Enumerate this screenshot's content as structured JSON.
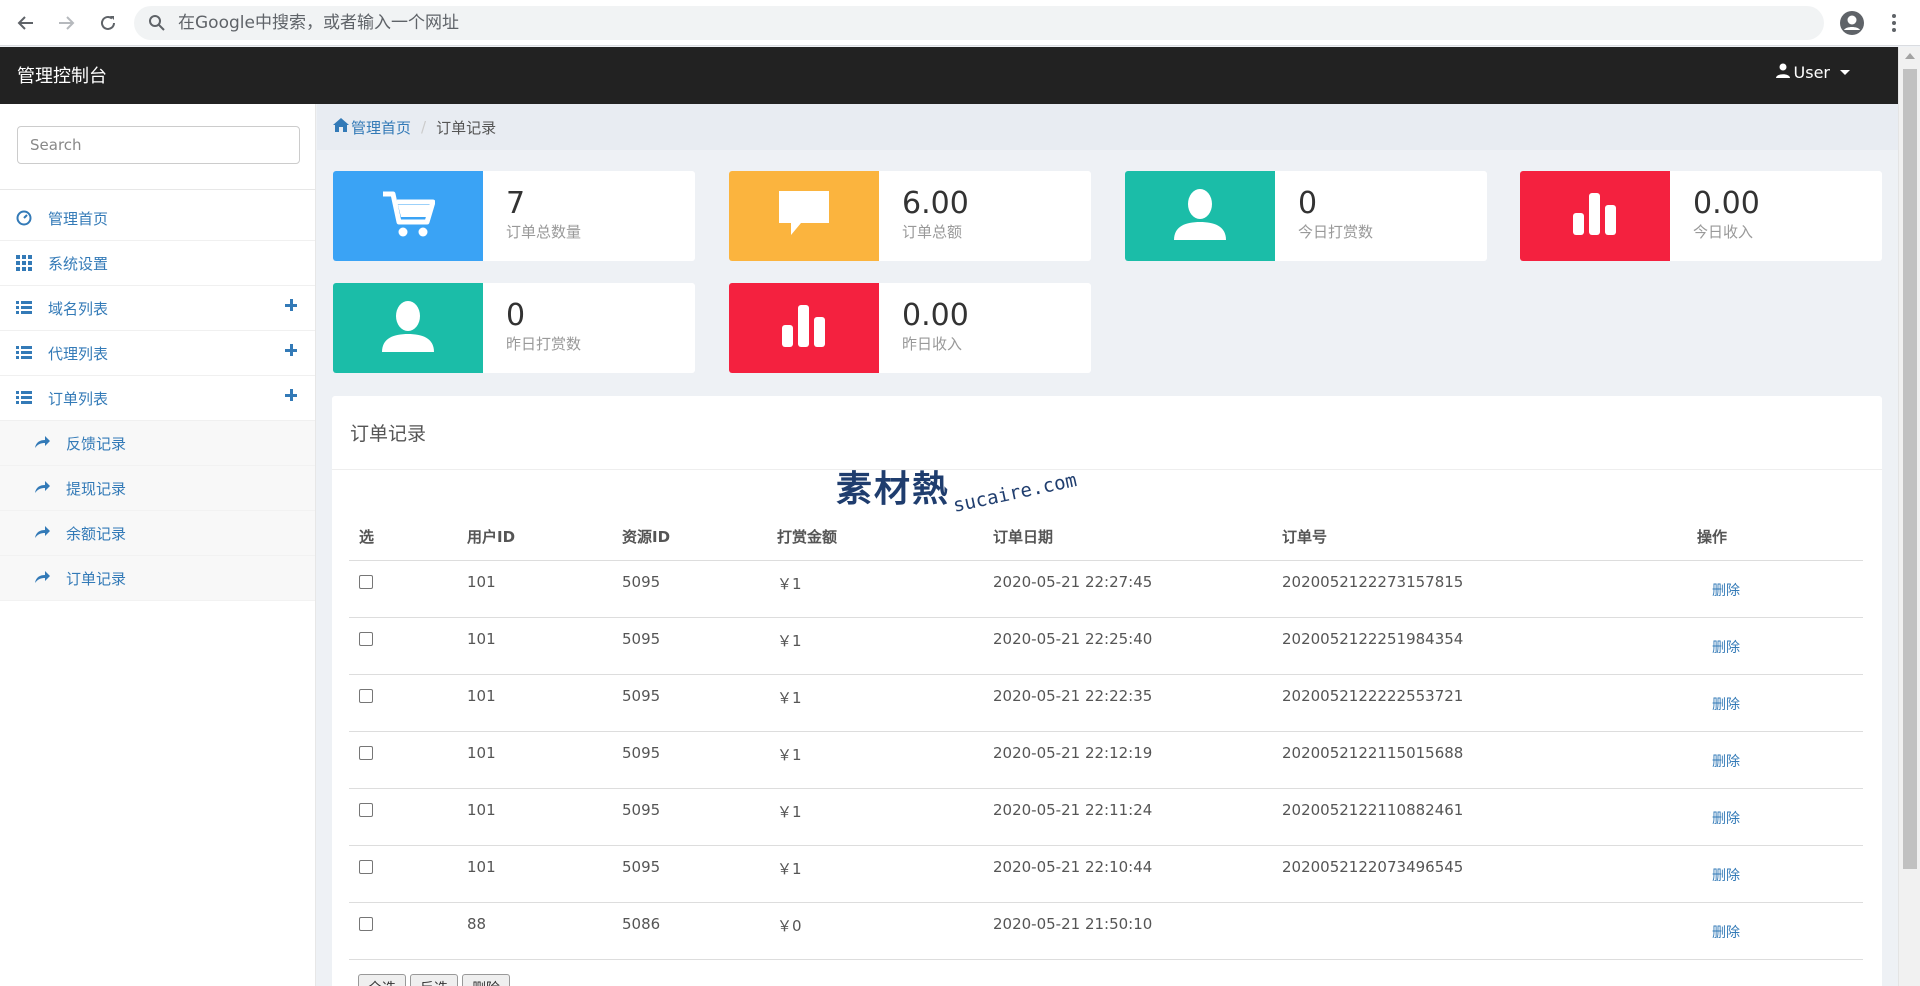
{
  "browser": {
    "omnibox_placeholder": "在Google中搜索，或者输入一个网址"
  },
  "navbar": {
    "brand": "管理控制台",
    "user_label": "User"
  },
  "sidebar": {
    "search_placeholder": "Search",
    "items": [
      {
        "label": "管理首页",
        "icon": "dashboard-icon",
        "expandable": false
      },
      {
        "label": "系统设置",
        "icon": "grid-icon",
        "expandable": false
      },
      {
        "label": "域名列表",
        "icon": "list-icon",
        "expandable": true
      },
      {
        "label": "代理列表",
        "icon": "list-icon",
        "expandable": true
      },
      {
        "label": "订单列表",
        "icon": "list-icon",
        "expandable": true
      }
    ],
    "sub_items": [
      {
        "label": "反馈记录",
        "icon": "share-arrow-icon"
      },
      {
        "label": "提现记录",
        "icon": "share-arrow-icon"
      },
      {
        "label": "余额记录",
        "icon": "share-arrow-icon"
      },
      {
        "label": "订单记录",
        "icon": "share-arrow-icon"
      }
    ]
  },
  "breadcrumb": {
    "home": "管理首页",
    "separator": "/",
    "current": "订单记录"
  },
  "stats": [
    {
      "value": "7",
      "label": "订单总数量",
      "icon": "cart-icon",
      "color": "#3aa3f5"
    },
    {
      "value": "6.00",
      "label": "订单总额",
      "icon": "comment-icon",
      "color": "#fbb43e"
    },
    {
      "value": "0",
      "label": "今日打赏数",
      "icon": "user-icon",
      "color": "#1bbda8"
    },
    {
      "value": "0.00",
      "label": "今日收入",
      "icon": "bar-chart-icon",
      "color": "#f4213f"
    },
    {
      "value": "0",
      "label": "昨日打赏数",
      "icon": "user-icon",
      "color": "#1bbda8"
    },
    {
      "value": "0.00",
      "label": "昨日收入",
      "icon": "bar-chart-icon",
      "color": "#f4213f"
    }
  ],
  "panel": {
    "title": "订单记录",
    "watermark_text": "素材熱",
    "watermark_url": "sucaire.com"
  },
  "table": {
    "headers": [
      "选",
      "用户ID",
      "资源ID",
      "打赏金额",
      "订单日期",
      "订单号",
      "操作"
    ],
    "delete_label": "删除",
    "rows": [
      {
        "uid": "101",
        "rid": "5095",
        "amount": "￥1",
        "date": "2020-05-21 22:27:45",
        "order_no": "2020052122273157815"
      },
      {
        "uid": "101",
        "rid": "5095",
        "amount": "￥1",
        "date": "2020-05-21 22:25:40",
        "order_no": "2020052122251984354"
      },
      {
        "uid": "101",
        "rid": "5095",
        "amount": "￥1",
        "date": "2020-05-21 22:22:35",
        "order_no": "2020052122222553721"
      },
      {
        "uid": "101",
        "rid": "5095",
        "amount": "￥1",
        "date": "2020-05-21 22:12:19",
        "order_no": "2020052122115015688"
      },
      {
        "uid": "101",
        "rid": "5095",
        "amount": "￥1",
        "date": "2020-05-21 22:11:24",
        "order_no": "2020052122110882461"
      },
      {
        "uid": "101",
        "rid": "5095",
        "amount": "￥1",
        "date": "2020-05-21 22:10:44",
        "order_no": "2020052122073496545"
      },
      {
        "uid": "88",
        "rid": "5086",
        "amount": "￥0",
        "date": "2020-05-21 21:50:10",
        "order_no": ""
      }
    ]
  },
  "bottom_buttons": [
    "全选",
    "反选",
    "删除"
  ]
}
